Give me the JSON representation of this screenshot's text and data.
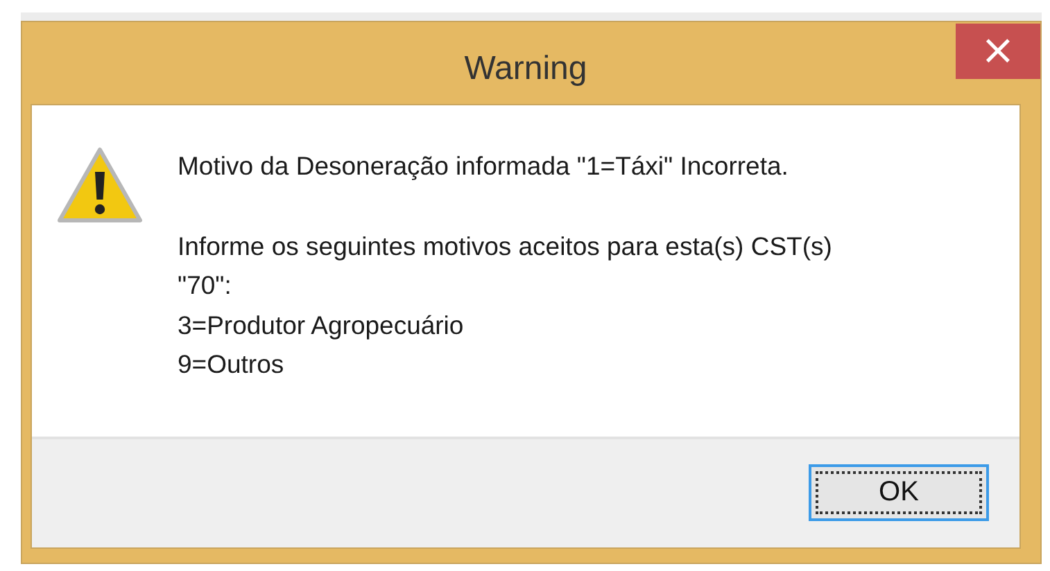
{
  "window": {
    "title": "Warning",
    "close": "×",
    "focused": true
  },
  "message": [
    {
      "lines": [
        "Motivo da Desoneração informada \"1=Táxi\" Incorreta."
      ]
    },
    {
      "lines": [
        "Informe os seguintes motivos aceitos para esta(s) CST(s)",
        "\"70\":",
        "3=Produtor Agropecuário",
        "9=Outros"
      ]
    }
  ],
  "buttons": [
    {
      "label": "OK",
      "focused": true
    }
  ]
}
